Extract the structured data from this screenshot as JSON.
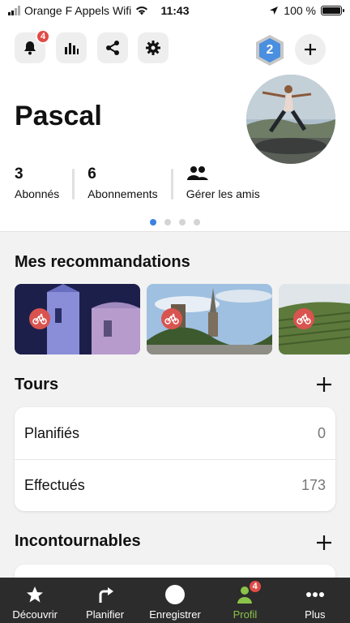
{
  "status_bar": {
    "carrier": "Orange F Appels Wifi",
    "time": "11:43",
    "battery": "100 %"
  },
  "header": {
    "notification_count": "4",
    "level": "2",
    "name": "Pascal",
    "stats": [
      {
        "value": "3",
        "label": "Abonnés"
      },
      {
        "value": "6",
        "label": "Abonnements"
      },
      {
        "label": "Gérer les amis"
      }
    ],
    "page_dots": {
      "count": 4,
      "active": 0
    }
  },
  "recommendations": {
    "title": "Mes recommandations"
  },
  "tours": {
    "title": "Tours",
    "rows": [
      {
        "label": "Planifiés",
        "value": "0"
      },
      {
        "label": "Effectués",
        "value": "173"
      }
    ]
  },
  "highlights": {
    "title": "Incontournables"
  },
  "tabbar": {
    "tabs": [
      {
        "label": "Découvrir",
        "icon": "star-icon"
      },
      {
        "label": "Planifier",
        "icon": "route-arrow-icon"
      },
      {
        "label": "Enregistrer",
        "icon": "record-icon"
      },
      {
        "label": "Profil",
        "icon": "person-icon",
        "badge": "4"
      },
      {
        "label": "Plus",
        "icon": "more-icon"
      }
    ],
    "active_color": "#8bc34a"
  },
  "colors": {
    "badge": "#e14b45",
    "accent_dot": "#3a83e0",
    "bike_badge": "#d9534f",
    "tabbar_bg": "#2c2c2c"
  }
}
